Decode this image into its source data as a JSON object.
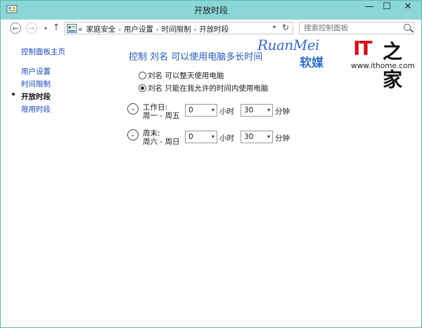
{
  "window": {
    "title": "开放时段",
    "min": "—",
    "max": "☐",
    "close": "✕"
  },
  "address": {
    "lead": "«",
    "crumbs": [
      "家庭安全",
      "用户设置",
      "时间限制",
      "开放时段"
    ],
    "sep": "›",
    "dropdown": "▾",
    "refresh": "↻"
  },
  "nav": {
    "back": "←",
    "forward": "→",
    "recent": "▾",
    "up": "↑"
  },
  "search": {
    "placeholder": "搜索控制面板"
  },
  "sidebar": {
    "home": "控制面板主页",
    "items": [
      "用户设置",
      "时间限制",
      "开放时段",
      "限用时段"
    ],
    "current_index": 2
  },
  "main": {
    "heading": "控制 刘名 可以使用电脑多长时间",
    "options": [
      {
        "label": "刘名 可以整天使用电脑",
        "selected": false
      },
      {
        "label": "刘名 只能在我允许的时间内使用电脑",
        "selected": true
      }
    ],
    "blocks": [
      {
        "title": "工作日:",
        "days": "周一 - 周五",
        "hours": "0",
        "minutes": "30"
      },
      {
        "title": "周末:",
        "days": "周六 - 周日",
        "hours": "0",
        "minutes": "30"
      }
    ],
    "hours_unit": "小时",
    "minutes_unit": "分钟",
    "expand_icon": "⌄",
    "select_arrow": "▾"
  },
  "watermark": {
    "brand": "RuanMei",
    "brand_cn": "软媒",
    "it": "IT",
    "glyph": "之家",
    "url": "www.ithome.com"
  }
}
